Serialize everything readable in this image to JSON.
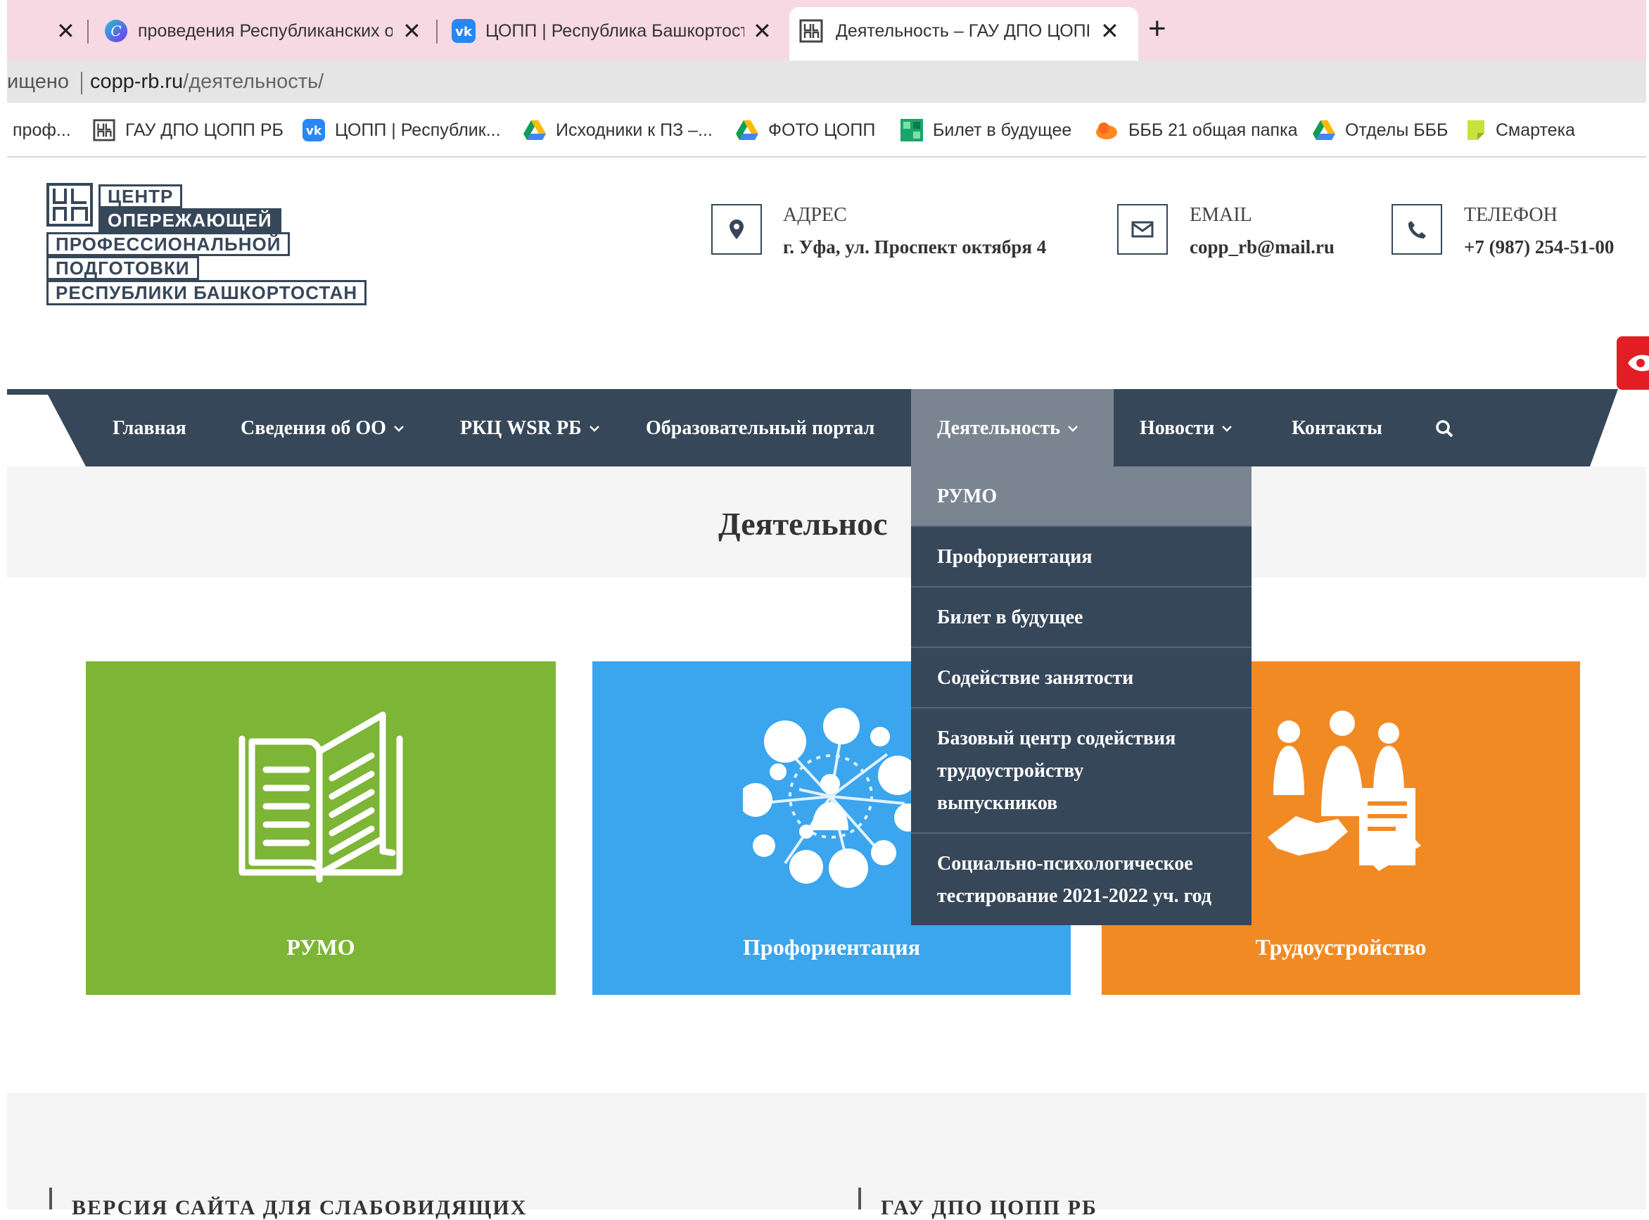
{
  "browser": {
    "tabs": [
      {
        "title": "",
        "close": "✕"
      },
      {
        "title": "проведения Республиканских о",
        "close": "✕"
      },
      {
        "title": "ЦОПП | Республика Башкортост",
        "close": "✕"
      },
      {
        "title": "Деятельность – ГАУ ДПО ЦОПП",
        "close": "✕"
      }
    ],
    "new_tab": "+",
    "address": {
      "secure_label": "ищено",
      "domain": "copp-rb.ru",
      "path": "/деятельность/"
    },
    "bookmarks": [
      {
        "label": "проф..."
      },
      {
        "label": "ГАУ ДПО ЦОПП РБ"
      },
      {
        "label": "ЦОПП | Республик..."
      },
      {
        "label": "Исходники к ПЗ –..."
      },
      {
        "label": "ФОТО ЦОПП"
      },
      {
        "label": "Билет в будущее"
      },
      {
        "label": "БББ 21 общая папка"
      },
      {
        "label": "Отделы БББ"
      },
      {
        "label": "Смартека"
      }
    ]
  },
  "logo": {
    "lines": [
      "ЦЕНТР",
      "ОПЕРЕЖАЮЩЕЙ",
      "ПРОФЕССИОНАЛЬНОЙ",
      "ПОДГОТОВКИ",
      "РЕСПУБЛИКИ БАШКОРТОСТАН"
    ],
    "mark": "ЦО\nПП"
  },
  "contacts": {
    "address": {
      "label": "АДРЕС",
      "value": "г. Уфа, ул. Проспект октября 4"
    },
    "email": {
      "label": "EMAIL",
      "value": "copp_rb@mail.ru"
    },
    "phone": {
      "label": "ТЕЛЕФОН",
      "value": "+7 (987) 254-51-00"
    }
  },
  "nav": {
    "items": [
      {
        "label": "Главная"
      },
      {
        "label": "Сведения об ОО"
      },
      {
        "label": "РКЦ WSR РБ"
      },
      {
        "label": "Образовательный портал"
      },
      {
        "label": "Деятельность"
      },
      {
        "label": "Новости"
      },
      {
        "label": "Контакты"
      }
    ],
    "dropdown": [
      {
        "lines": [
          "РУМО"
        ]
      },
      {
        "lines": [
          "Профориентация"
        ]
      },
      {
        "lines": [
          "Билет в будущее"
        ]
      },
      {
        "lines": [
          "Содействие занятости"
        ]
      },
      {
        "lines": [
          "Базовый центр содействия",
          "трудоустройству",
          "выпускников"
        ]
      },
      {
        "lines": [
          "Социально-психологическое",
          "тестирование 2021-2022 уч. год"
        ]
      }
    ]
  },
  "page": {
    "title": "Деятельнос"
  },
  "cards": [
    {
      "label": "РУМО",
      "color": "#7db536"
    },
    {
      "label": "Профориентация",
      "color": "#3ba5ee"
    },
    {
      "label": "Трудоустройство",
      "color": "#f28a24"
    }
  ],
  "footer": {
    "left": "ВЕРСИЯ САЙТА ДЛЯ СЛАБОВИДЯЩИХ",
    "right": "ГАУ ДПО ЦОПП РБ"
  },
  "colors": {
    "nav_bg": "#37475a",
    "nav_active": "#7b8591",
    "tabstrip": "#f6d9e3",
    "accessibility_red": "#e21e24"
  }
}
